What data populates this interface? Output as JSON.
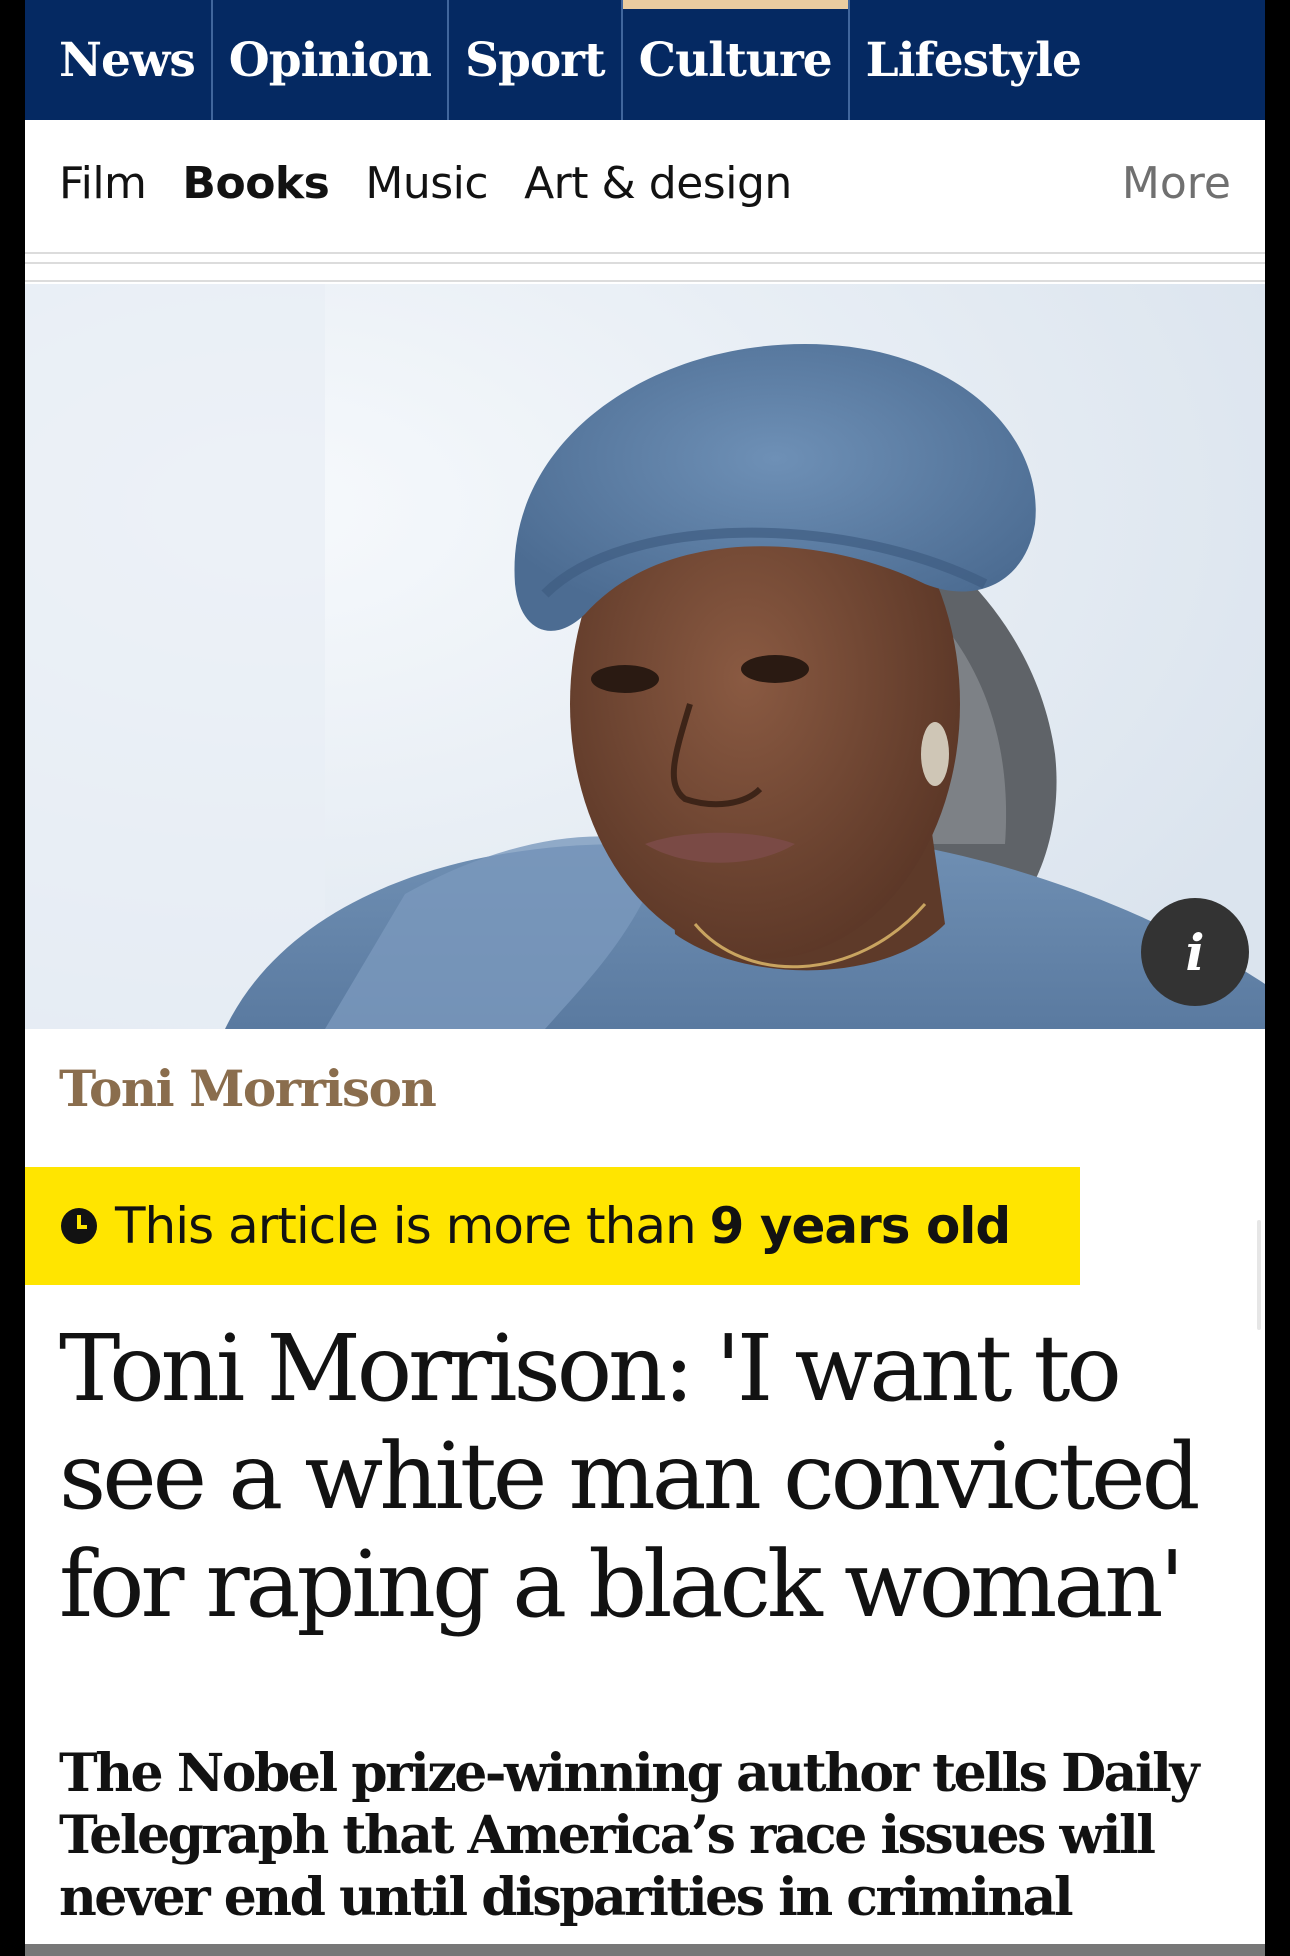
{
  "topnav": {
    "items": [
      "News",
      "Opinion",
      "Sport",
      "Culture",
      "Lifestyle"
    ],
    "active": "Culture",
    "accent": "#eacca0",
    "background": "#052962"
  },
  "subnav": {
    "items": [
      "Film",
      "Books",
      "Music",
      "Art & design"
    ],
    "active": "Books",
    "more": "More"
  },
  "hero": {
    "info_icon": "i"
  },
  "article": {
    "kicker": "Toni Morrison",
    "age_prefix": "This article is more than",
    "age_value": "9 years old",
    "headline": "Toni Morrison: 'I want to see a white man convicted for raping a black woman'",
    "standfirst": "The Nobel prize-winning author tells Daily Telegraph that America’s race issues will never end until disparities in criminal"
  },
  "colors": {
    "kicker": "#8a6d4d",
    "age_banner": "#ffe500"
  }
}
